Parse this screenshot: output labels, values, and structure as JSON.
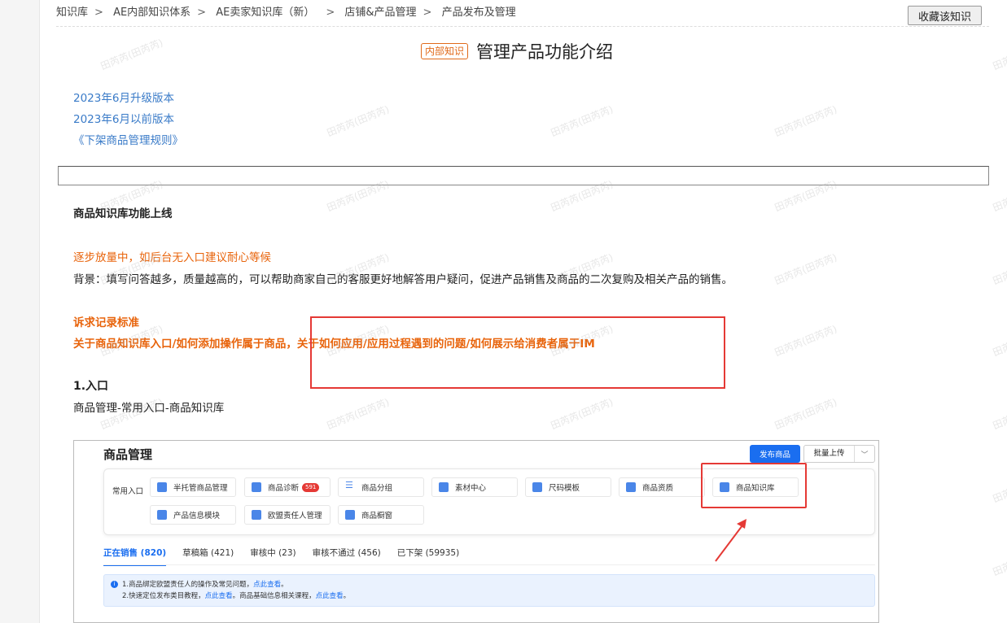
{
  "breadcrumb": [
    "知识库",
    "AE内部知识体系",
    "AE卖家知识库（新）",
    "店铺&产品管理",
    "产品发布及管理"
  ],
  "favorite_button": "收藏该知识",
  "title_tag": "内部知识",
  "title": "管理产品功能介绍",
  "links": [
    "2023年6月升级版本",
    "2023年6月以前版本",
    "《下架商品管理规则》"
  ],
  "section_title": "商品知识库功能上线",
  "rollout_note": "逐步放量中，如后台无入口建议耐心等候",
  "background": "背景：填写问答越多，质量越高的，可以帮助商家自己的客服更好地解答用户疑问，促进产品销售及商品的二次复购及相关产品的销售。",
  "standard_title": "诉求记录标准",
  "standard_text": "关于商品知识库入口/如何添加操作属于商品，关于如何应用/应用过程遇到的问题/如何展示给消费者属于IM",
  "entry_heading": "1.入口",
  "entry_path": "商品管理-常用入口-商品知识库",
  "watermark": "田芮芮(田芮芮)",
  "screenshot": {
    "title": "商品管理",
    "publish_button": "发布商品",
    "bulk_upload": "批量上传",
    "quick_label": "常用入口",
    "quick_items": [
      {
        "label": "半托管商品管理"
      },
      {
        "label": "商品诊断",
        "badge": "591"
      },
      {
        "label": "商品分组"
      },
      {
        "label": "素材中心"
      },
      {
        "label": "尺码模板"
      },
      {
        "label": "商品资质"
      },
      {
        "label": "商品知识库"
      },
      {
        "label": "产品信息模块"
      },
      {
        "label": "欧盟责任人管理"
      },
      {
        "label": "商品橱窗"
      }
    ],
    "tabs": [
      "正在销售 (820)",
      "草稿箱 (421)",
      "审核中 (23)",
      "审核不通过 (456)",
      "已下架 (59935)"
    ],
    "notice_1_prefix": "1.商品绑定欧盟责任人的操作及常见问题，",
    "notice_link": "点此查看",
    "notice_1_suffix": "。",
    "notice_2_prefix": "2.快速定位发布类目教程，",
    "notice_2_mid": "。商品基础信息相关课程，",
    "notice_2_suffix": "。"
  },
  "colors": {
    "accent_orange": "#e8640c",
    "link_blue": "#3a7bc8",
    "highlight_red": "#e53935",
    "primary_blue": "#1a6ef0"
  }
}
